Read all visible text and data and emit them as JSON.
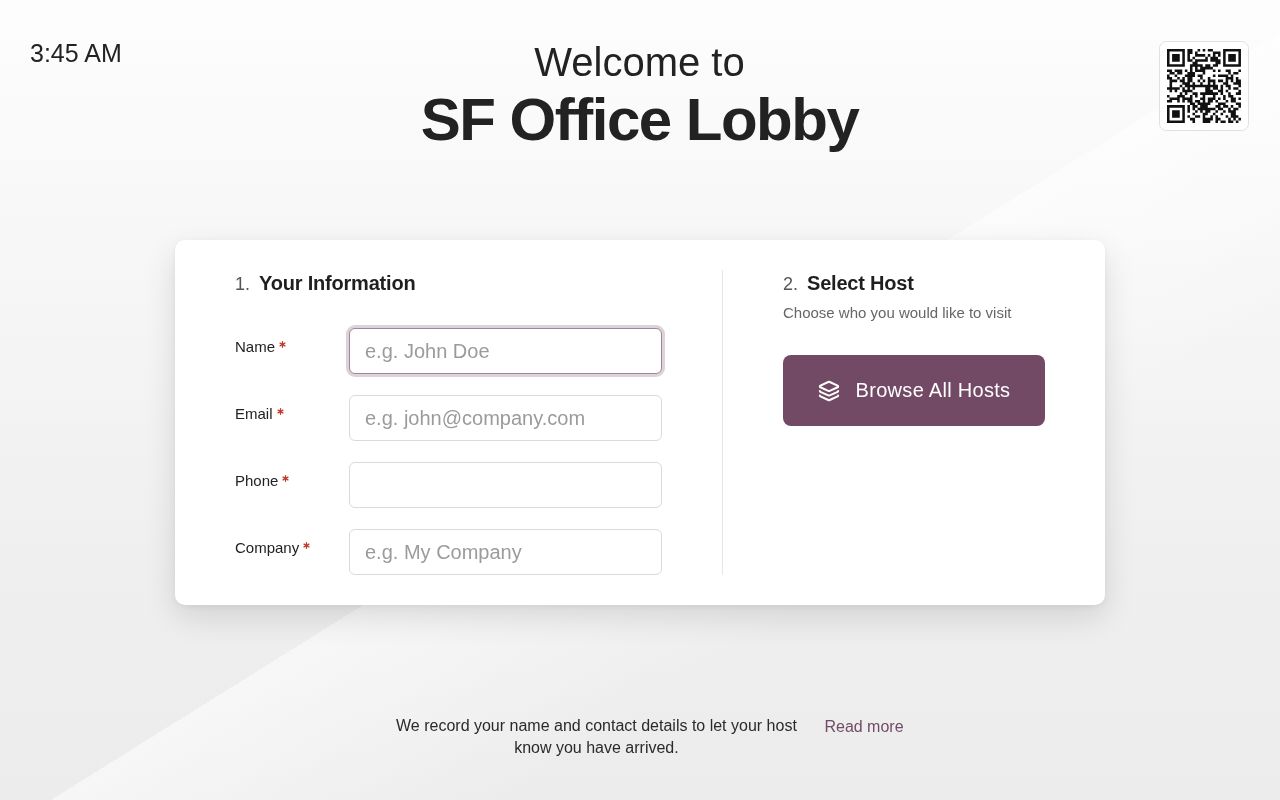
{
  "clock": {
    "time": "3:45 AM"
  },
  "header": {
    "greeting": "Welcome to",
    "location": "SF Office Lobby"
  },
  "visitor_info": {
    "number": "1.",
    "title": "Your Information",
    "fields": [
      {
        "label": "Name",
        "required": true,
        "placeholder": "e.g. John Doe",
        "focused": true
      },
      {
        "label": "Email",
        "required": true,
        "placeholder": "e.g. john@company.com",
        "focused": false
      },
      {
        "label": "Phone",
        "required": true,
        "focused": false
      },
      {
        "label": "Company",
        "required": true,
        "placeholder": "e.g. My Company",
        "focused": false
      }
    ]
  },
  "host_selection": {
    "number": "2.",
    "title": "Select Host",
    "subtitle": "Choose who you would like to visit",
    "button": {
      "label": "Browse All Hosts"
    }
  },
  "footer": {
    "notice": "We record your name and contact details to let your host know you have arrived.",
    "link": "Read more"
  }
}
